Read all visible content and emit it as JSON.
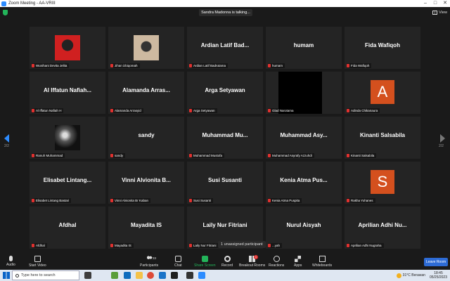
{
  "window": {
    "title": "Zoom Meeting - AA-VRIII",
    "controls": [
      "–",
      "□",
      "✕"
    ]
  },
  "top": {
    "talking": "Sandra Madonna is talking...",
    "view_label": "View"
  },
  "pager": {
    "left": "2/2",
    "right": "2/2"
  },
  "tiles": [
    {
      "name": "",
      "label": "Wunihani Devita Jelita",
      "video": "photo-red"
    },
    {
      "name": "",
      "label": "Jihan izbiqomah",
      "video": "photo-beige"
    },
    {
      "name": "Ardian Latif Bad...",
      "label": "Ardian Latif Badrutama"
    },
    {
      "name": "humam",
      "label": "humam"
    },
    {
      "name": "Fida Wafiqoh",
      "label": "Fida Wafiqoh"
    },
    {
      "name": "Al Iffatun Nafiah...",
      "label": "Al Iffatun Nafiah H"
    },
    {
      "name": "Alamanda Arras...",
      "label": "Alamanda Arrasyid"
    },
    {
      "name": "Arga Setyawan",
      "label": "Arga Setyawan"
    },
    {
      "name": "",
      "label": "Glad Narotama",
      "video": "black"
    },
    {
      "name": "",
      "label": "Adinda Chikanaura",
      "avatar": "A"
    },
    {
      "name": "",
      "label": "Ranuh Muhammad",
      "video": "photo-bw"
    },
    {
      "name": "sandy",
      "label": "sandy"
    },
    {
      "name": "Muhammad Mu...",
      "label": "Muhammad Mustofa"
    },
    {
      "name": "Muhammad Asy...",
      "label": "Muhammad Asyrafy Azzuhdi"
    },
    {
      "name": "Kinanti Salsabila",
      "label": "Kinanti Salsabila"
    },
    {
      "name": "Elisabet Lintang...",
      "label": "Elisabet Lintang Bastari"
    },
    {
      "name": "Vinni Alvionita B...",
      "label": "Vinni Alvionita Br Kaban"
    },
    {
      "name": "Susi Susanti",
      "label": "Susi Susanti"
    },
    {
      "name": "Kenia Atma Pus...",
      "label": "Kenia Atma Puspita"
    },
    {
      "name": "",
      "label": "Rakha Yohanes",
      "avatar": "S"
    },
    {
      "name": "Afdhal",
      "label": "Afdhal"
    },
    {
      "name": "Mayadita IS",
      "label": "Mayadita IS"
    },
    {
      "name": "Laily Nur Fitriani",
      "label": "Laily Nur Fitriani"
    },
    {
      "name": "Nurul Aisyah",
      "label": "...yah"
    },
    {
      "name": "Aprilian Adhi Nu...",
      "label": "Aprilian Adhi Nugraha"
    }
  ],
  "tooltip": "1 unassigned participant",
  "toolbar": {
    "audio": "Audio",
    "video": "Start Video",
    "participants": "Participants",
    "participants_count": "33",
    "chat": "Chat",
    "share": "Share Screen",
    "record": "Record",
    "breakout": "Breakout Rooms",
    "breakout_badge": "1",
    "reactions": "Reactions",
    "apps": "Apps",
    "whiteboards": "Whiteboards",
    "leave": "Leave Room"
  },
  "taskbar": {
    "search_placeholder": "Type here to search",
    "weather": "31°C  Berawan",
    "time": "18:45",
    "date": "05/25/2023"
  },
  "colors": {
    "accent": "#2d8cff",
    "muted": "#e0312f",
    "avatar": "#d4501e"
  }
}
